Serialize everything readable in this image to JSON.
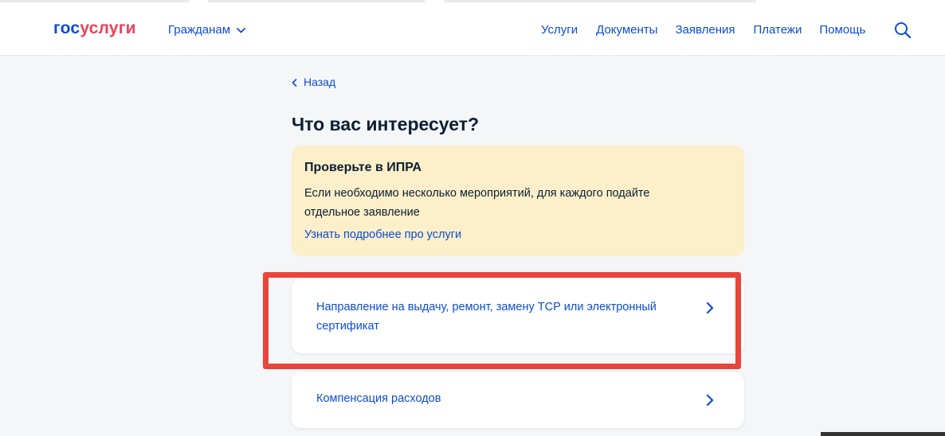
{
  "header": {
    "logo_part1": "гос",
    "logo_part2": "услуги",
    "citizens_label": "Гражданам",
    "nav": [
      "Услуги",
      "Документы",
      "Заявления",
      "Платежи",
      "Помощь"
    ]
  },
  "page": {
    "back_label": "Назад",
    "title": "Что вас интересует?"
  },
  "notice": {
    "title": "Проверьте в ИПРА",
    "text": "Если необходимо несколько мероприятий, для каждого подайте отдельное заявление",
    "link": "Узнать подробнее про услуги"
  },
  "options": [
    {
      "label": "Направление на выдачу, ремонт, замену ТСР или электронный сертификат"
    },
    {
      "label": "Компенсация расходов"
    }
  ],
  "colors": {
    "brand_blue": "#0d4cd3",
    "brand_red": "#ee3f58",
    "notice_bg": "#fcefc9",
    "highlight": "#e8453c"
  },
  "icons": {
    "citizens_chevron": "chevron-down-icon",
    "search": "search-icon",
    "back": "chevron-left-icon",
    "option": "chevron-right-icon"
  }
}
